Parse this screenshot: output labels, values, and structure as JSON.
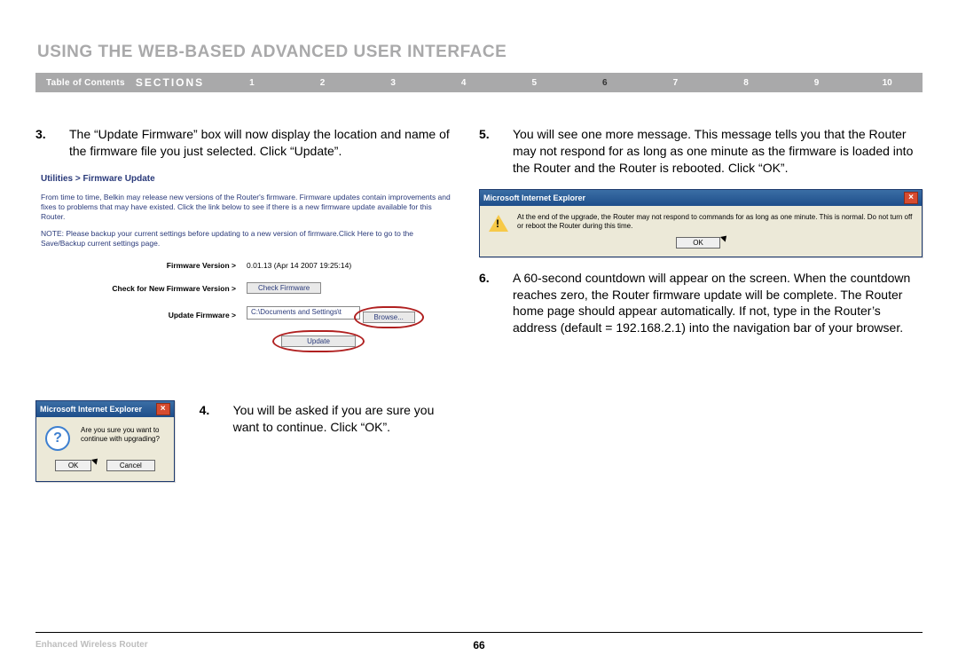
{
  "heading": "USING THE WEB-BASED ADVANCED USER INTERFACE",
  "nav": {
    "toc": "Table of Contents",
    "sections_label": "SECTIONS",
    "items": [
      "1",
      "2",
      "3",
      "4",
      "5",
      "6",
      "7",
      "8",
      "9",
      "10"
    ],
    "active": "6"
  },
  "steps": {
    "s3": {
      "n": "3.",
      "t": "The “Update Firmware” box will now display the location and name of the firmware file you just selected. Click “Update”."
    },
    "s4": {
      "n": "4.",
      "t": "You will be asked if you are sure you want to continue. Click “OK”."
    },
    "s5": {
      "n": "5.",
      "t": "You will see one more message. This message tells you that the Router may not respond for as long as one minute as the firmware is loaded into the Router and the Router is rebooted. Click “OK”."
    },
    "s6": {
      "n": "6.",
      "t": "A 60-second countdown will appear on the screen. When the countdown reaches zero, the Router firmware update will be complete. The Router home page should appear automatically. If not, type in the Router’s address (default = 192.168.2.1) into the navigation bar of your browser."
    }
  },
  "fw": {
    "crumb": "Utilities > Firmware Update",
    "desc": "From time to time, Belkin may release new versions of the Router's firmware. Firmware updates contain improvements and fixes to problems that may have existed. Click the link below to see if there is a new firmware update available for this Router.",
    "note": "NOTE: Please backup your current settings before updating to a new version of firmware.Click Here to go to the Save/Backup current settings page.",
    "rows": {
      "ver_label": "Firmware Version >",
      "ver_value": "0.01.13 (Apr 14 2007 19:25:14)",
      "check_label": "Check for New Firmware Version >",
      "check_btn": "Check Firmware",
      "upd_label": "Update Firmware >",
      "upd_path": "C:\\Documents and Settings\\t",
      "browse_btn": "Browse...",
      "update_btn": "Update"
    }
  },
  "dlg1": {
    "title": "Microsoft Internet Explorer",
    "msg": "Are you sure you want to continue with upgrading?",
    "ok": "OK",
    "cancel": "Cancel"
  },
  "dlg2": {
    "title": "Microsoft Internet Explorer",
    "msg": "At the end of the upgrade, the Router may not respond to commands for as long as one minute. This is normal. Do not turn off or reboot the Router during this time.",
    "ok": "OK"
  },
  "footer": {
    "product": "Enhanced Wireless Router",
    "page": "66"
  }
}
